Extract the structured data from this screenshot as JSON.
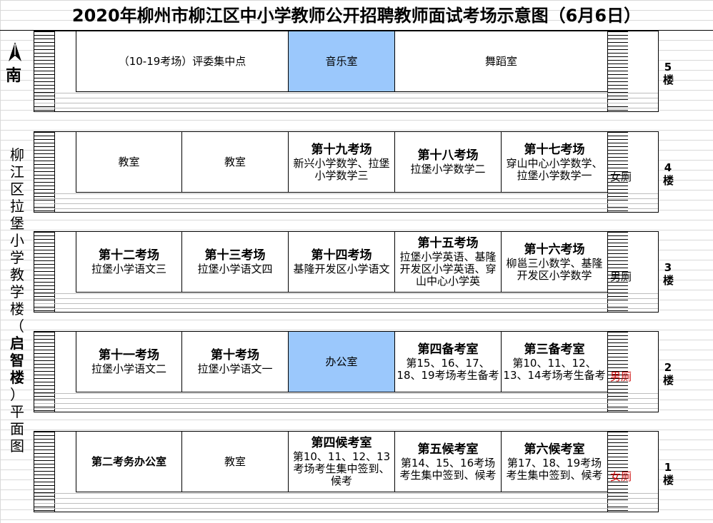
{
  "title": "2020年柳州市柳江区中小学教师公开招聘教师面试考场示意图（6月6日）",
  "compass": {
    "label": "南",
    "icon": "north-arrow-icon"
  },
  "building_title": [
    "柳",
    "江",
    "区",
    "拉",
    "堡",
    "小",
    "学",
    "教",
    "学",
    "楼",
    "（",
    "启",
    "智",
    "楼",
    "）",
    "平",
    "面",
    "图"
  ],
  "floors": [
    {
      "label": [
        "5",
        "楼"
      ],
      "wc": "",
      "rooms": [
        {
          "name": "",
          "desc": "（10-19考场）评委集中点",
          "span": 2,
          "blue": false
        },
        {
          "name": "",
          "desc": "音乐室",
          "span": 1,
          "blue": true
        },
        {
          "name": "",
          "desc": "舞蹈室",
          "span": 2,
          "blue": false
        }
      ]
    },
    {
      "label": [
        "4",
        "楼"
      ],
      "wc": "女厕",
      "wc_red": false,
      "rooms": [
        {
          "name": "",
          "desc": "教室",
          "span": 1,
          "blue": false
        },
        {
          "name": "",
          "desc": "教室",
          "span": 1,
          "blue": false
        },
        {
          "name": "第十九考场",
          "desc": "新兴小学数学、拉堡小学数学三",
          "span": 1,
          "blue": false
        },
        {
          "name": "第十八考场",
          "desc": "拉堡小学数学二",
          "span": 1,
          "blue": false
        },
        {
          "name": "第十七考场",
          "desc": "穿山中心小学数学、拉堡小学数学一",
          "span": 1,
          "blue": false
        }
      ]
    },
    {
      "label": [
        "3",
        "楼"
      ],
      "wc": "男厕",
      "wc_red": false,
      "rooms": [
        {
          "name": "第十二考场",
          "desc": "拉堡小学语文三",
          "span": 1,
          "blue": false
        },
        {
          "name": "第十三考场",
          "desc": "拉堡小学语文四",
          "span": 1,
          "blue": false
        },
        {
          "name": "第十四考场",
          "desc": "基隆开发区小学语文",
          "span": 1,
          "blue": false
        },
        {
          "name": "第十五考场",
          "desc": "拉堡小学英语、基隆开发区小学英语、穿山中心小学英",
          "span": 1,
          "blue": false
        },
        {
          "name": "第十六考场",
          "desc": "柳邕三小数学、基隆开发区小学数学",
          "span": 1,
          "blue": false
        }
      ]
    },
    {
      "label": [
        "2",
        "楼"
      ],
      "wc": "男厕",
      "wc_red": true,
      "rooms": [
        {
          "name": "第十一考场",
          "desc": "拉堡小学语文二",
          "span": 1,
          "blue": false
        },
        {
          "name": "第十考场",
          "desc": "拉堡小学语文一",
          "span": 1,
          "blue": false
        },
        {
          "name": "",
          "desc": "办公室",
          "span": 1,
          "blue": true
        },
        {
          "name": "第四备考室",
          "desc": "第15、16、17、18、19考场考生备考",
          "span": 1,
          "blue": false
        },
        {
          "name": "第三备考室",
          "desc": "第10、11、12、13、14考场考生备考",
          "span": 1,
          "blue": false
        }
      ]
    },
    {
      "label": [
        "1",
        "楼"
      ],
      "wc": "女厕",
      "wc_red": true,
      "rooms": [
        {
          "name": "",
          "desc": "第二考务办公室",
          "span": 1,
          "blue": false,
          "bold": true
        },
        {
          "name": "",
          "desc": "教室",
          "span": 1,
          "blue": false
        },
        {
          "name": "第四候考室",
          "desc": "第10、11、12、13考场考生集中签到、候考",
          "span": 1,
          "blue": false
        },
        {
          "name": "第五候考室",
          "desc": "第14、15、16考场考生集中签到、候考",
          "span": 1,
          "blue": false
        },
        {
          "name": "第六候考室",
          "desc": "第17、18、19考场考生集中签到、候考",
          "span": 1,
          "blue": false
        }
      ]
    }
  ]
}
